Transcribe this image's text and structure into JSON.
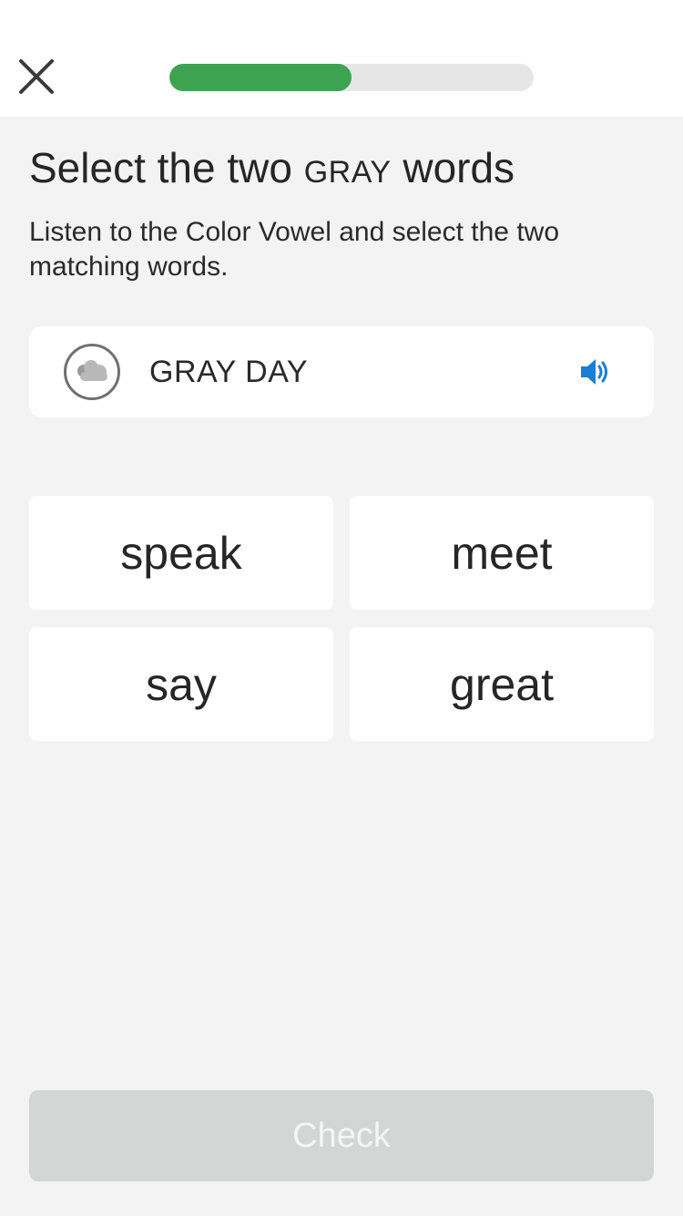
{
  "header": {
    "close_icon": "close-icon",
    "progress_fraction": 0.5,
    "progress_color": "#3da351"
  },
  "prompt": {
    "title_prefix": "Select the two",
    "title_color_word": "GRAY",
    "title_suffix": "words",
    "instructions": "Listen to the Color Vowel and select the two matching words."
  },
  "vowel": {
    "icon": "cloud-icon",
    "label": "GRAY DAY",
    "audio_icon": "speaker-icon",
    "audio_color": "#1a7fd4"
  },
  "options": [
    {
      "word": "speak"
    },
    {
      "word": "meet"
    },
    {
      "word": "say"
    },
    {
      "word": "great"
    }
  ],
  "footer": {
    "check_label": "Check"
  }
}
